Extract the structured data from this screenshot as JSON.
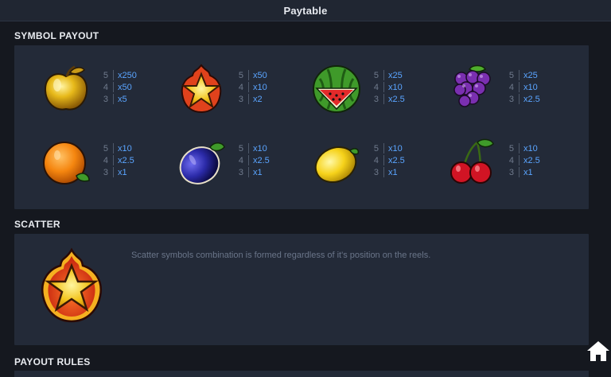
{
  "header": {
    "title": "Paytable"
  },
  "sections": {
    "symbol_payout": "SYMBOL PAYOUT",
    "scatter": "SCATTER",
    "payout_rules": "PAYOUT RULES"
  },
  "symbols": [
    {
      "icon": "apple-icon",
      "payouts": [
        {
          "count": "5",
          "mult": "x250"
        },
        {
          "count": "4",
          "mult": "x50"
        },
        {
          "count": "3",
          "mult": "x5"
        }
      ]
    },
    {
      "icon": "star-icon",
      "payouts": [
        {
          "count": "5",
          "mult": "x50"
        },
        {
          "count": "4",
          "mult": "x10"
        },
        {
          "count": "3",
          "mult": "x2"
        }
      ]
    },
    {
      "icon": "watermelon-icon",
      "payouts": [
        {
          "count": "5",
          "mult": "x25"
        },
        {
          "count": "4",
          "mult": "x10"
        },
        {
          "count": "3",
          "mult": "x2.5"
        }
      ]
    },
    {
      "icon": "grapes-icon",
      "payouts": [
        {
          "count": "5",
          "mult": "x25"
        },
        {
          "count": "4",
          "mult": "x10"
        },
        {
          "count": "3",
          "mult": "x2.5"
        }
      ]
    },
    {
      "icon": "orange-icon",
      "payouts": [
        {
          "count": "5",
          "mult": "x10"
        },
        {
          "count": "4",
          "mult": "x2.5"
        },
        {
          "count": "3",
          "mult": "x1"
        }
      ]
    },
    {
      "icon": "plum-icon",
      "payouts": [
        {
          "count": "5",
          "mult": "x10"
        },
        {
          "count": "4",
          "mult": "x2.5"
        },
        {
          "count": "3",
          "mult": "x1"
        }
      ]
    },
    {
      "icon": "lemon-icon",
      "payouts": [
        {
          "count": "5",
          "mult": "x10"
        },
        {
          "count": "4",
          "mult": "x2.5"
        },
        {
          "count": "3",
          "mult": "x1"
        }
      ]
    },
    {
      "icon": "cherries-icon",
      "payouts": [
        {
          "count": "5",
          "mult": "x10"
        },
        {
          "count": "4",
          "mult": "x2.5"
        },
        {
          "count": "3",
          "mult": "x1"
        }
      ]
    }
  ],
  "scatter": {
    "icon": "scatter-fire-star-icon",
    "description": "Scatter symbols combination is formed regardless of it's position on the reels."
  },
  "controls": {
    "home_icon": "home-icon"
  },
  "colors": {
    "background": "#15181f",
    "panel": "#232a38",
    "multiplier": "#5aa4ff",
    "count": "#6f7a8c"
  }
}
